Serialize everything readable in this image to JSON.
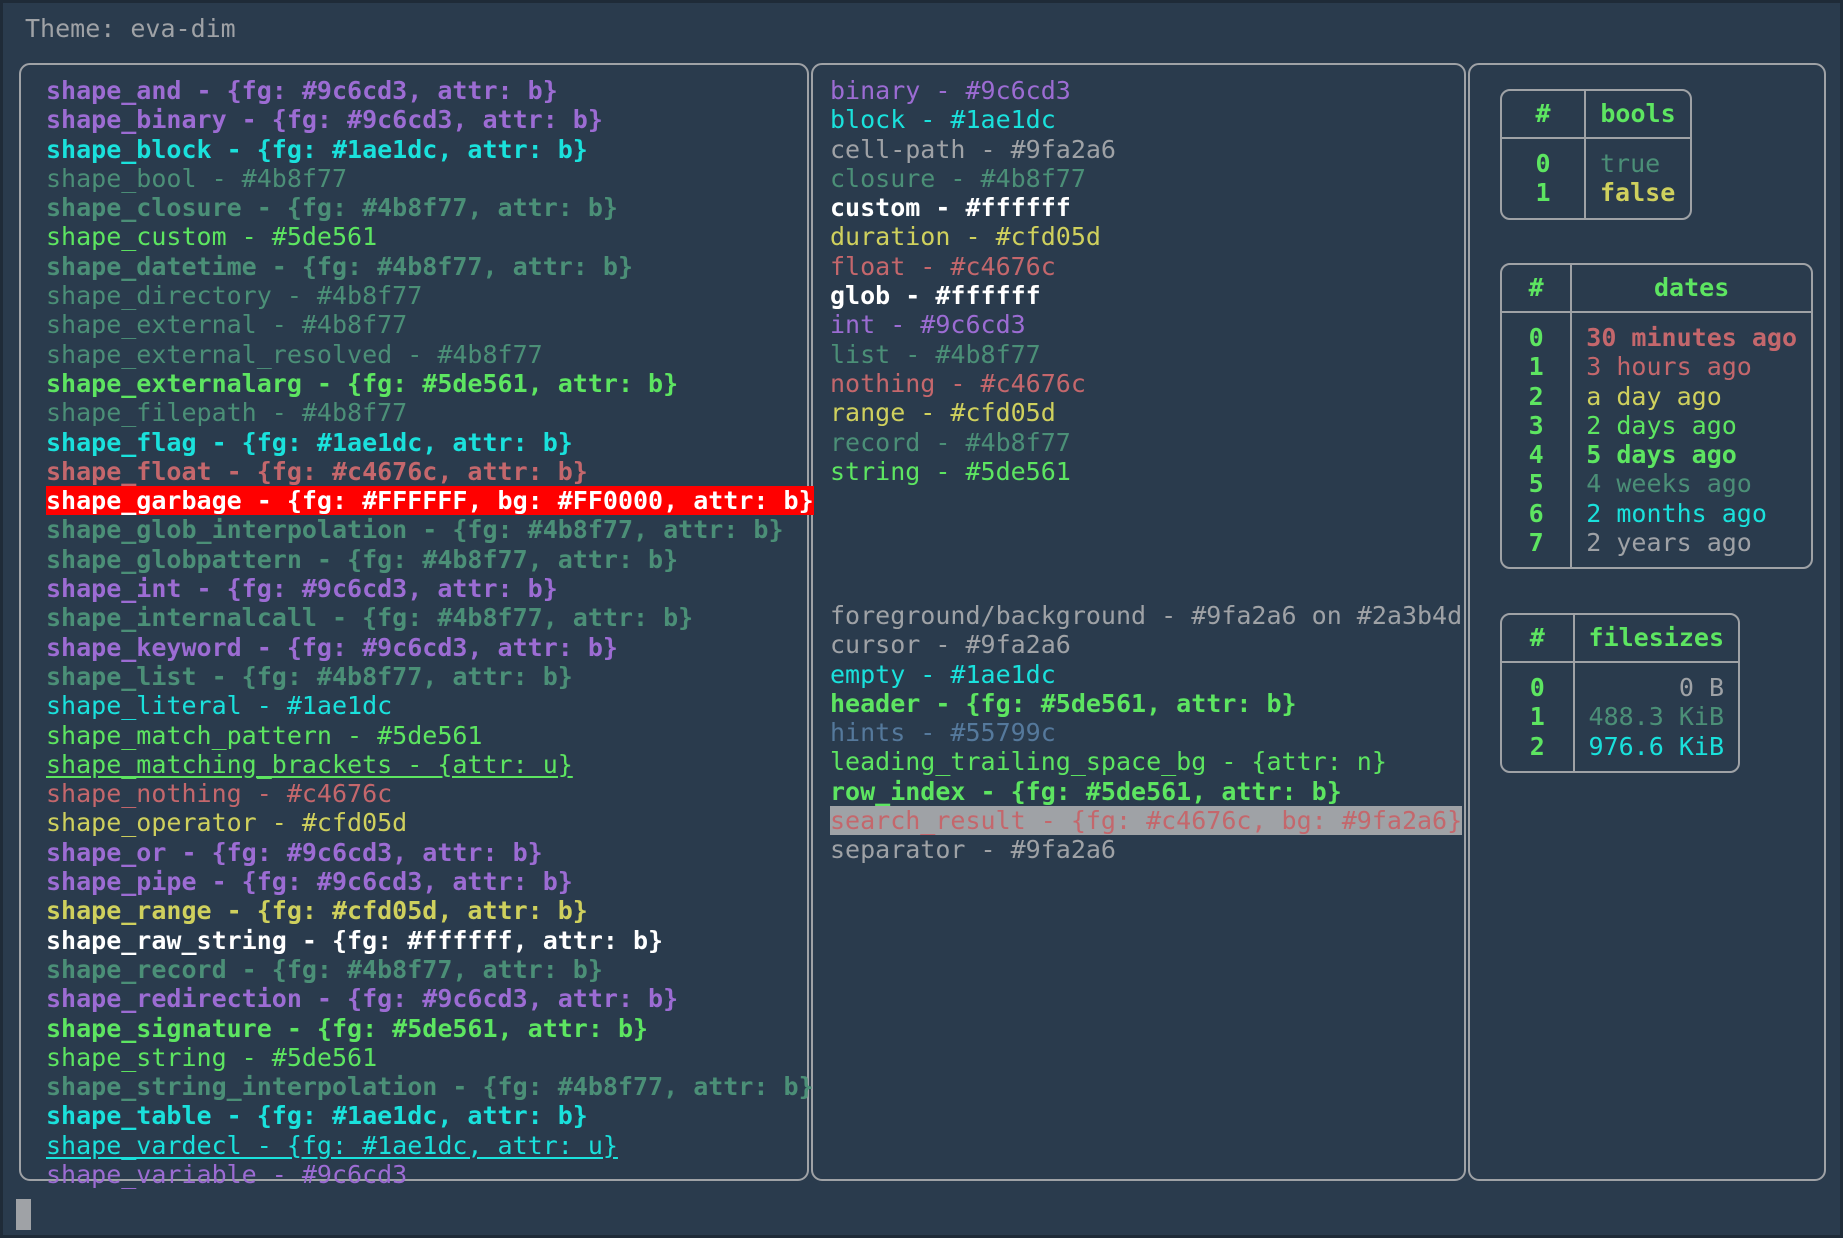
{
  "header": {
    "theme_label": "Theme: eva-dim"
  },
  "colors": {
    "background": "#2a3b4d",
    "outer_background": "#1f2b38",
    "foreground": "#9fa2a6",
    "border": "#9fa2a6",
    "purple": "#9c6cd3",
    "cyan": "#1ae1dc",
    "dim_green": "#4b8f77",
    "green": "#5de561",
    "red": "#c4676c",
    "yellow": "#cfd05d",
    "white": "#ffffff",
    "hints": "#55799c",
    "garbage_fg": "#FFFFFF",
    "garbage_bg": "#FF0000",
    "search_result_bg": "#9fa2a6"
  },
  "left_panel": {
    "rows": [
      {
        "text": "shape_and - {fg: #9c6cd3, attr: b}",
        "color": "#9c6cd3",
        "bold": true
      },
      {
        "text": "shape_binary - {fg: #9c6cd3, attr: b}",
        "color": "#9c6cd3",
        "bold": true
      },
      {
        "text": "shape_block - {fg: #1ae1dc, attr: b}",
        "color": "#1ae1dc",
        "bold": true
      },
      {
        "text": "shape_bool - #4b8f77",
        "color": "#4b8f77",
        "bold": false
      },
      {
        "text": "shape_closure - {fg: #4b8f77, attr: b}",
        "color": "#4b8f77",
        "bold": true
      },
      {
        "text": "shape_custom - #5de561",
        "color": "#5de561",
        "bold": false
      },
      {
        "text": "shape_datetime - {fg: #4b8f77, attr: b}",
        "color": "#4b8f77",
        "bold": true
      },
      {
        "text": "shape_directory - #4b8f77",
        "color": "#4b8f77",
        "bold": false
      },
      {
        "text": "shape_external - #4b8f77",
        "color": "#4b8f77",
        "bold": false
      },
      {
        "text": "shape_external_resolved - #4b8f77",
        "color": "#4b8f77",
        "bold": false
      },
      {
        "text": "shape_externalarg - {fg: #5de561, attr: b}",
        "color": "#5de561",
        "bold": true
      },
      {
        "text": "shape_filepath - #4b8f77",
        "color": "#4b8f77",
        "bold": false
      },
      {
        "text": "shape_flag - {fg: #1ae1dc, attr: b}",
        "color": "#1ae1dc",
        "bold": true
      },
      {
        "text": "shape_float - {fg: #c4676c, attr: b}",
        "color": "#c4676c",
        "bold": true
      },
      {
        "text": "shape_garbage - {fg: #FFFFFF, bg: #FF0000, attr: b}",
        "color": "#FFFFFF",
        "bg": "#FF0000",
        "bold": true
      },
      {
        "text": "shape_glob_interpolation - {fg: #4b8f77, attr: b}",
        "color": "#4b8f77",
        "bold": true
      },
      {
        "text": "shape_globpattern - {fg: #4b8f77, attr: b}",
        "color": "#4b8f77",
        "bold": true
      },
      {
        "text": "shape_int - {fg: #9c6cd3, attr: b}",
        "color": "#9c6cd3",
        "bold": true
      },
      {
        "text": "shape_internalcall - {fg: #4b8f77, attr: b}",
        "color": "#4b8f77",
        "bold": true
      },
      {
        "text": "shape_keyword - {fg: #9c6cd3, attr: b}",
        "color": "#9c6cd3",
        "bold": true
      },
      {
        "text": "shape_list - {fg: #4b8f77, attr: b}",
        "color": "#4b8f77",
        "bold": true
      },
      {
        "text": "shape_literal - #1ae1dc",
        "color": "#1ae1dc",
        "bold": false
      },
      {
        "text": "shape_match_pattern - #5de561",
        "color": "#5de561",
        "bold": false
      },
      {
        "text": "shape_matching_brackets - {attr: u}",
        "color": "#5de561",
        "bold": false,
        "underline": true
      },
      {
        "text": "shape_nothing - #c4676c",
        "color": "#c4676c",
        "bold": false
      },
      {
        "text": "shape_operator - #cfd05d",
        "color": "#cfd05d",
        "bold": false
      },
      {
        "text": "shape_or - {fg: #9c6cd3, attr: b}",
        "color": "#9c6cd3",
        "bold": true
      },
      {
        "text": "shape_pipe - {fg: #9c6cd3, attr: b}",
        "color": "#9c6cd3",
        "bold": true
      },
      {
        "text": "shape_range - {fg: #cfd05d, attr: b}",
        "color": "#cfd05d",
        "bold": true
      },
      {
        "text": "shape_raw_string - {fg: #ffffff, attr: b}",
        "color": "#ffffff",
        "bold": true
      },
      {
        "text": "shape_record - {fg: #4b8f77, attr: b}",
        "color": "#4b8f77",
        "bold": true
      },
      {
        "text": "shape_redirection - {fg: #9c6cd3, attr: b}",
        "color": "#9c6cd3",
        "bold": true
      },
      {
        "text": "shape_signature - {fg: #5de561, attr: b}",
        "color": "#5de561",
        "bold": true
      },
      {
        "text": "shape_string - #5de561",
        "color": "#5de561",
        "bold": false
      },
      {
        "text": "shape_string_interpolation - {fg: #4b8f77, attr: b}",
        "color": "#4b8f77",
        "bold": true
      },
      {
        "text": "shape_table - {fg: #1ae1dc, attr: b}",
        "color": "#1ae1dc",
        "bold": true
      },
      {
        "text": "shape_vardecl - {fg: #1ae1dc, attr: u}",
        "color": "#1ae1dc",
        "bold": false,
        "underline": true
      },
      {
        "text": "shape_variable - #9c6cd3",
        "color": "#9c6cd3",
        "bold": false
      }
    ]
  },
  "middle_panel_top": {
    "rows": [
      {
        "text": "binary - #9c6cd3",
        "color": "#9c6cd3",
        "bold": false
      },
      {
        "text": "block - #1ae1dc",
        "color": "#1ae1dc",
        "bold": false
      },
      {
        "text": "cell-path - #9fa2a6",
        "color": "#9fa2a6",
        "bold": false
      },
      {
        "text": "closure - #4b8f77",
        "color": "#4b8f77",
        "bold": false
      },
      {
        "text": "custom - #ffffff",
        "color": "#ffffff",
        "bold": true
      },
      {
        "text": "duration - #cfd05d",
        "color": "#cfd05d",
        "bold": false
      },
      {
        "text": "float - #c4676c",
        "color": "#c4676c",
        "bold": false
      },
      {
        "text": "glob - #ffffff",
        "color": "#ffffff",
        "bold": true
      },
      {
        "text": "int - #9c6cd3",
        "color": "#9c6cd3",
        "bold": false
      },
      {
        "text": "list - #4b8f77",
        "color": "#4b8f77",
        "bold": false
      },
      {
        "text": "nothing - #c4676c",
        "color": "#c4676c",
        "bold": false
      },
      {
        "text": "range - #cfd05d",
        "color": "#cfd05d",
        "bold": false
      },
      {
        "text": "record - #4b8f77",
        "color": "#4b8f77",
        "bold": false
      },
      {
        "text": "string - #5de561",
        "color": "#5de561",
        "bold": false
      }
    ]
  },
  "middle_panel_bottom": {
    "rows": [
      {
        "text": "foreground/background - #9fa2a6 on #2a3b4d",
        "color": "#9fa2a6",
        "bold": false
      },
      {
        "text": "cursor - #9fa2a6",
        "color": "#9fa2a6",
        "bold": false
      },
      {
        "text": "empty - #1ae1dc",
        "color": "#1ae1dc",
        "bold": false
      },
      {
        "text": "header - {fg: #5de561, attr: b}",
        "color": "#5de561",
        "bold": true
      },
      {
        "text": "hints - #55799c",
        "color": "#55799c",
        "bold": false
      },
      {
        "text": "leading_trailing_space_bg - {attr: n}",
        "color": "#5de561",
        "bold": false
      },
      {
        "text": "row_index - {fg: #5de561, attr: b}",
        "color": "#5de561",
        "bold": true
      },
      {
        "text": "search_result - {fg: #c4676c, bg: #9fa2a6}",
        "color": "#c4676c",
        "bg": "#9fa2a6",
        "bold": false
      },
      {
        "text": "separator - #9fa2a6",
        "color": "#9fa2a6",
        "bold": false
      }
    ]
  },
  "tables": {
    "bools": {
      "columns": [
        "#",
        "bools"
      ],
      "rows": [
        {
          "index": "0",
          "value": "true",
          "color": "#4b8f77",
          "bold": false
        },
        {
          "index": "1",
          "value": "false",
          "color": "#cfd05d",
          "bold": true
        }
      ]
    },
    "dates": {
      "columns": [
        "#",
        "dates"
      ],
      "rows": [
        {
          "index": "0",
          "value": "30 minutes ago",
          "color": "#c4676c",
          "bold": true
        },
        {
          "index": "1",
          "value": "3 hours ago",
          "color": "#c4676c",
          "bold": false
        },
        {
          "index": "2",
          "value": "a day ago",
          "color": "#cfd05d",
          "bold": false
        },
        {
          "index": "3",
          "value": "2 days ago",
          "color": "#5de561",
          "bold": false
        },
        {
          "index": "4",
          "value": "5 days ago",
          "color": "#5de561",
          "bold": true
        },
        {
          "index": "5",
          "value": "4 weeks ago",
          "color": "#4b8f77",
          "bold": false
        },
        {
          "index": "6",
          "value": "2 months ago",
          "color": "#1ae1dc",
          "bold": false
        },
        {
          "index": "7",
          "value": "2 years ago",
          "color": "#9fa2a6",
          "bold": false
        }
      ]
    },
    "filesizes": {
      "columns": [
        "#",
        "filesizes"
      ],
      "rows": [
        {
          "index": "0",
          "value": "0 B",
          "color": "#9fa2a6",
          "bold": false
        },
        {
          "index": "1",
          "value": "488.3 KiB",
          "color": "#4b8f77",
          "bold": false
        },
        {
          "index": "2",
          "value": "976.6 KiB",
          "color": "#1ae1dc",
          "bold": false
        }
      ]
    }
  },
  "terminal": {
    "cursor_present": true
  }
}
